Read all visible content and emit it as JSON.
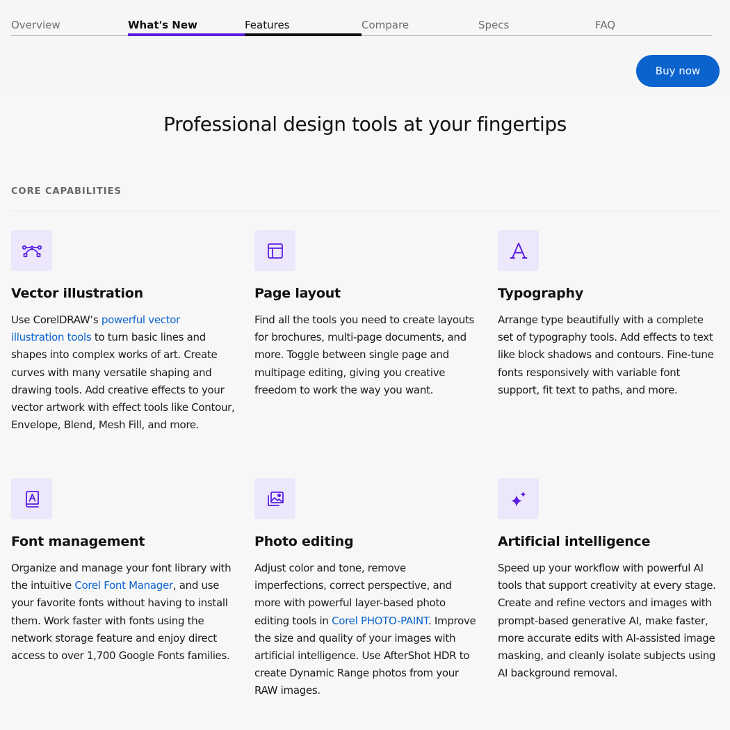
{
  "nav": {
    "tabs": [
      {
        "label": "Overview"
      },
      {
        "label": "What's New"
      },
      {
        "label": "Features"
      },
      {
        "label": "Compare"
      },
      {
        "label": "Specs"
      },
      {
        "label": "FAQ"
      }
    ],
    "buy_label": "Buy now"
  },
  "colors": {
    "accent": "#5b1ee0",
    "link": "#0b63ce",
    "icon_bg": "#ece7fb"
  },
  "headline": "Professional design tools at your fingertips",
  "section_label": "CORE CAPABILITIES",
  "cards": [
    {
      "icon": "vector-path-icon",
      "title": "Vector illustration",
      "p1": "Use CorelDRAW’s ",
      "link": "powerful vector illustration tools",
      "p2": " to turn basic lines and shapes into complex works of art. Create curves with many versatile shaping and drawing tools. Add creative effects to your vector artwork with effect tools like Contour, Envelope, Blend, Mesh Fill, and more."
    },
    {
      "icon": "page-layout-icon",
      "title": "Page layout",
      "text": "Find all the tools you need to create layouts for brochures, multi-page documents, and more. Toggle between single page and multipage editing, giving you creative freedom to work the way you want."
    },
    {
      "icon": "typography-icon",
      "title": "Typography",
      "text": "Arrange type beautifully with a complete set of typography tools. Add effects to text like block shadows and contours. Fine-tune fonts responsively with variable font support, fit text to paths, and more."
    },
    {
      "icon": "font-book-icon",
      "title": "Font management",
      "p1": "Organize and manage your font library with the intuitive ",
      "link": "Corel Font Manager",
      "p2": ", and use your favorite fonts without having to install them. Work faster with fonts using the network storage feature and enjoy direct access to over 1,700 Google Fonts families."
    },
    {
      "icon": "photo-gallery-icon",
      "title": "Photo editing",
      "p1": "Adjust color and tone, remove imperfections, correct perspective, and more with powerful layer-based photo editing tools in ",
      "link": "Corel PHOTO-PAINT",
      "p2": ". Improve the size and quality of your images with artificial intelligence. Use AfterShot HDR to create Dynamic Range photos from your RAW images."
    },
    {
      "icon": "sparkle-icon",
      "title": "Artificial intelligence",
      "text": "Speed up your workflow with powerful AI tools that support creativity at every stage. Create and refine vectors and images with prompt-based generative AI, make faster, more accurate edits with AI-assisted image masking, and cleanly isolate subjects using AI background removal."
    }
  ]
}
